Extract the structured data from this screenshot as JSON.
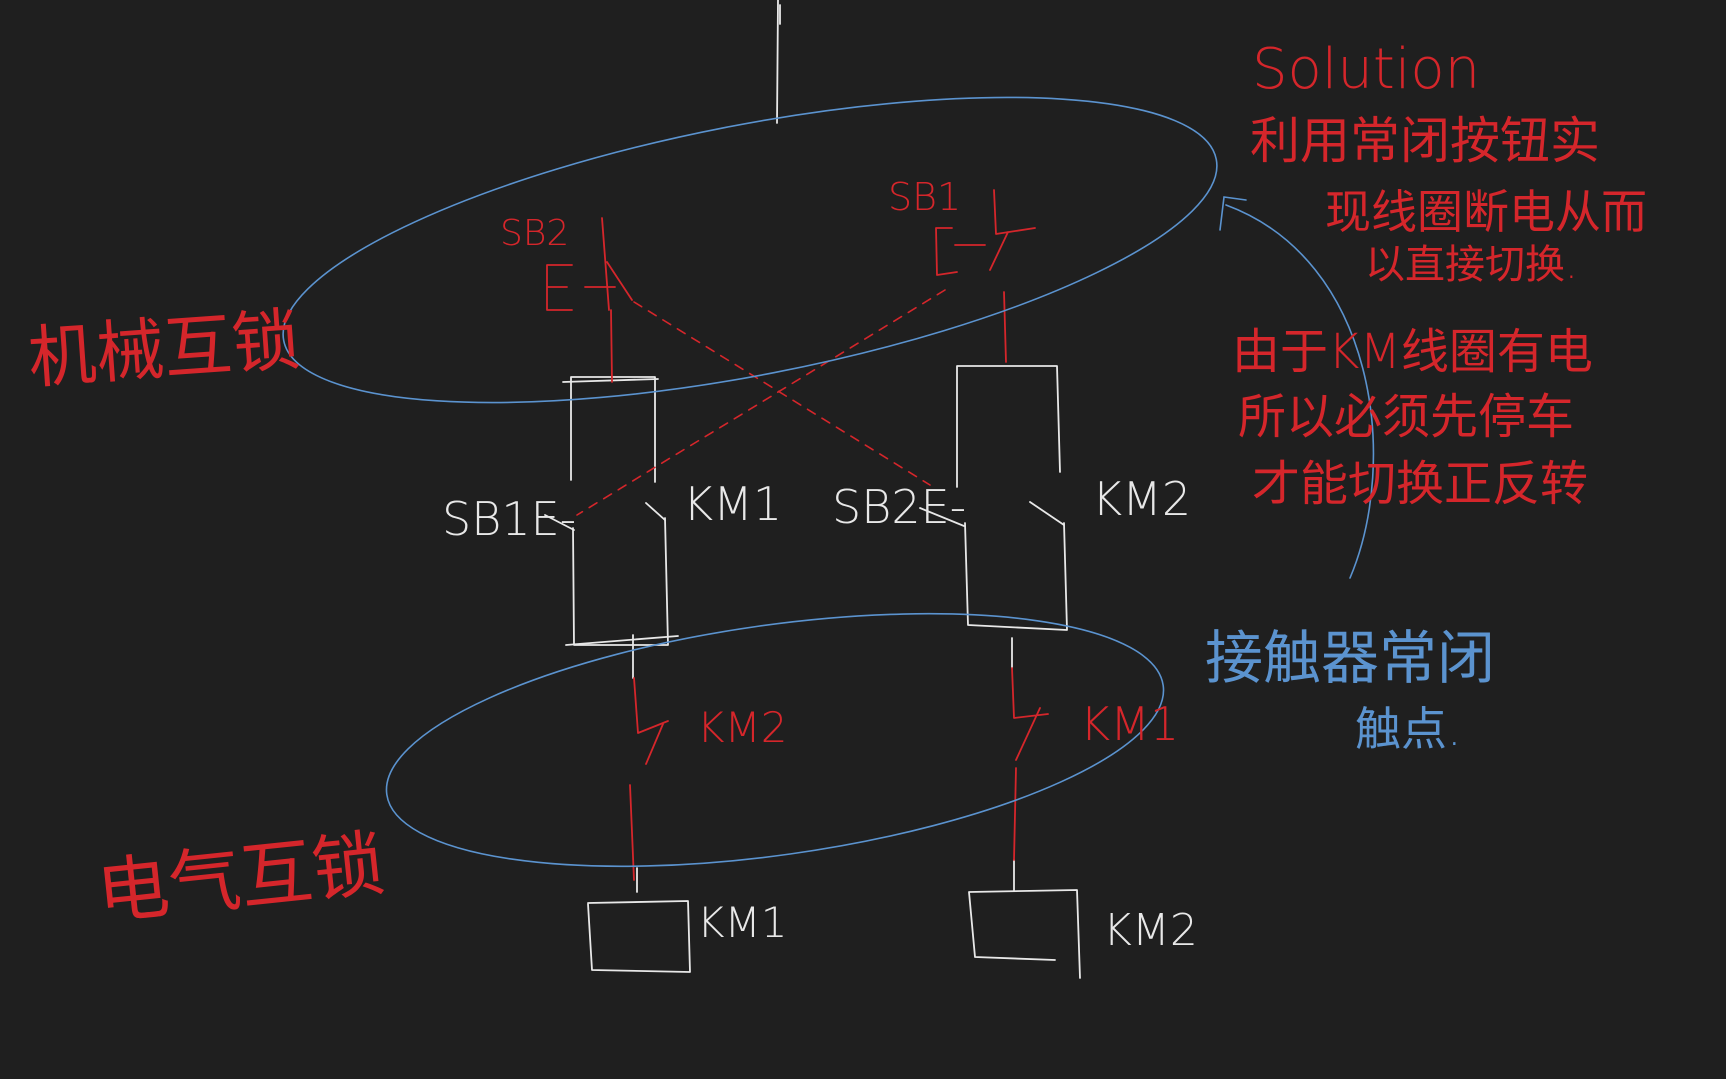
{
  "colors": {
    "background": "#1f1f1f",
    "white_ink": "#e8e8e8",
    "red_ink": "#d5262b",
    "blue_ink": "#5b93cf"
  },
  "labels": {
    "sb2_top": "SB2",
    "sb1_top": "SB1",
    "sb1_bottom": "SB1E-",
    "sb2_bottom": "SB2E-",
    "km1_contact": "KM1",
    "km2_contact": "KM2",
    "km2_interlock": "KM2",
    "km1_interlock": "KM1",
    "km1_coil": "KM1",
    "km2_coil": "KM2",
    "mechanical_interlock": "机械互锁",
    "electrical_interlock": "电气互锁"
  },
  "notes": {
    "solution_title": "Solution",
    "solution_line1": "利用常闭按钮实",
    "solution_line2": "现线圈断电从而",
    "solution_line3": "以直接切换.",
    "reason_line1": "由于KM线圈有电",
    "reason_line2": "所以必须先停车",
    "reason_line3": "才能切换正反转",
    "contact_line1": "接触器常闭",
    "contact_line2": "触点."
  }
}
